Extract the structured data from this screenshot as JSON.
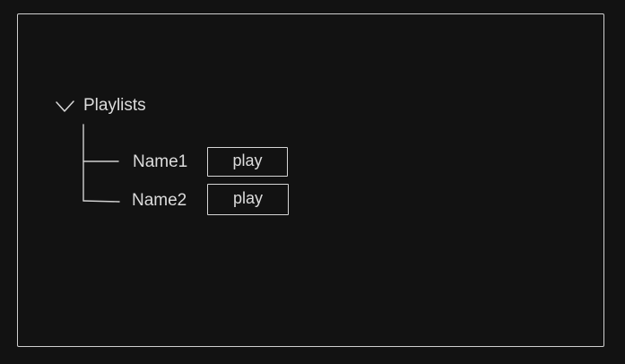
{
  "tree": {
    "title": "Playlists",
    "expand_icon": "chevron-down-icon",
    "items": [
      {
        "name": "Name1",
        "action_label": "play"
      },
      {
        "name": "Name2",
        "action_label": "play"
      }
    ]
  },
  "colors": {
    "background": "#121212",
    "stroke": "#d5d5d5",
    "text": "#dcdcdc"
  }
}
